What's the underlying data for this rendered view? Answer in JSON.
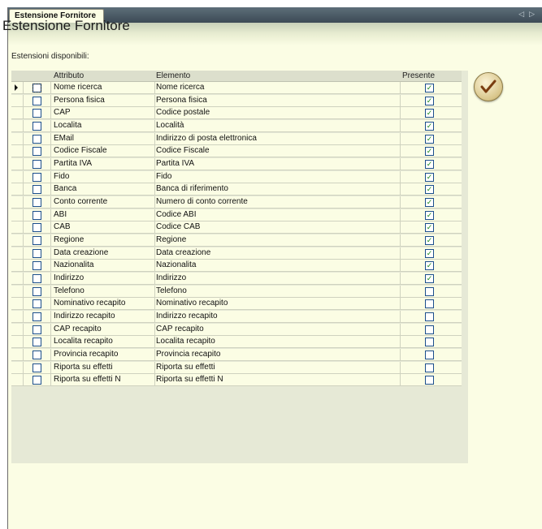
{
  "tab": {
    "label": "Estensione Fornitore"
  },
  "page": {
    "title": "Estensione Fornitore"
  },
  "section": {
    "label": "Estensioni disponibili:"
  },
  "columns": {
    "attribute": "Attributo",
    "element": "Elemento",
    "present": "Presente"
  },
  "rows": [
    {
      "attribute": "Nome ricerca",
      "element": "Nome ricerca",
      "present": true
    },
    {
      "attribute": "Persona fisica",
      "element": "Persona fisica",
      "present": true
    },
    {
      "attribute": "CAP",
      "element": "Codice postale",
      "present": true
    },
    {
      "attribute": "Localita",
      "element": "Località",
      "present": true
    },
    {
      "attribute": "EMail",
      "element": "Indirizzo di posta elettronica",
      "present": true
    },
    {
      "attribute": "Codice Fiscale",
      "element": "Codice Fiscale",
      "present": true
    },
    {
      "attribute": "Partita IVA",
      "element": "Partita IVA",
      "present": true
    },
    {
      "attribute": "Fido",
      "element": "Fido",
      "present": true
    },
    {
      "attribute": "Banca",
      "element": "Banca di riferimento",
      "present": true
    },
    {
      "attribute": "Conto corrente",
      "element": "Numero di conto corrente",
      "present": true
    },
    {
      "attribute": "ABI",
      "element": "Codice ABI",
      "present": true
    },
    {
      "attribute": "CAB",
      "element": "Codice CAB",
      "present": true
    },
    {
      "attribute": "Regione",
      "element": "Regione",
      "present": true
    },
    {
      "attribute": "Data creazione",
      "element": "Data creazione",
      "present": true
    },
    {
      "attribute": "Nazionalita",
      "element": "Nazionalita",
      "present": true
    },
    {
      "attribute": "Indirizzo",
      "element": "Indirizzo",
      "present": true
    },
    {
      "attribute": "Telefono",
      "element": "Telefono",
      "present": false
    },
    {
      "attribute": "Nominativo recapito",
      "element": "Nominativo recapito",
      "present": false
    },
    {
      "attribute": "Indirizzo recapito",
      "element": "Indirizzo recapito",
      "present": false
    },
    {
      "attribute": "CAP recapito",
      "element": "CAP recapito",
      "present": false
    },
    {
      "attribute": "Localita recapito",
      "element": "Localita recapito",
      "present": false
    },
    {
      "attribute": "Provincia recapito",
      "element": "Provincia recapito",
      "present": false
    },
    {
      "attribute": "Riporta su effetti",
      "element": "Riporta su effetti",
      "present": false
    },
    {
      "attribute": "Riporta su effetti N",
      "element": "Riporta su effetti N",
      "present": false
    }
  ],
  "icons": {
    "confirm": "checkmark-icon",
    "tab_nav": "tab-scroll-arrows-icon",
    "current_row": "row-pointer-icon"
  },
  "colors": {
    "background": "#fbfde4",
    "tabstrip": "#4a5a66",
    "check": "#18871a",
    "checkbox_border": "#1c4e8c"
  }
}
